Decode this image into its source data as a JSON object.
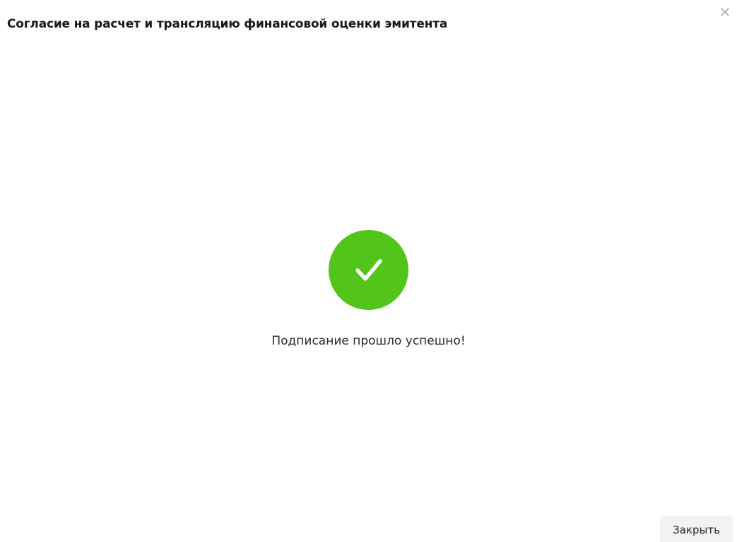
{
  "dialog": {
    "title": "Согласие на расчет и трансляцию финансовой оценки эмитента",
    "close_icon": "close-icon",
    "success": {
      "icon": "checkmark-icon",
      "color": "#52c41a",
      "message": "Подписание прошло успешно!"
    },
    "footer": {
      "close_label": "Закрыть"
    }
  }
}
